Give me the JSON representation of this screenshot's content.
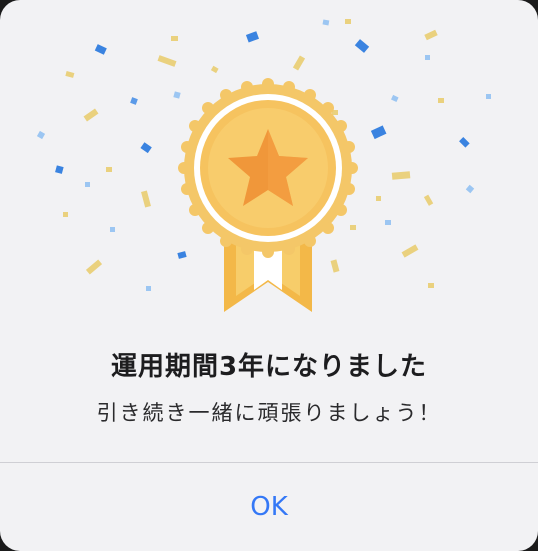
{
  "dialog": {
    "title": "運用期間3年になりました",
    "message": "引き続き一緒に頑張りましょう！",
    "ok_label": "OK"
  },
  "colors": {
    "background": "#f2f2f4",
    "accent": "#3478f6",
    "medal_gold": "#f5c35c",
    "confetti_blue": "#2f7fe0",
    "confetti_gold": "#e8c860"
  },
  "illustration": {
    "medal_icon": "star-medal-icon",
    "confetti_icon": "confetti-icon"
  }
}
